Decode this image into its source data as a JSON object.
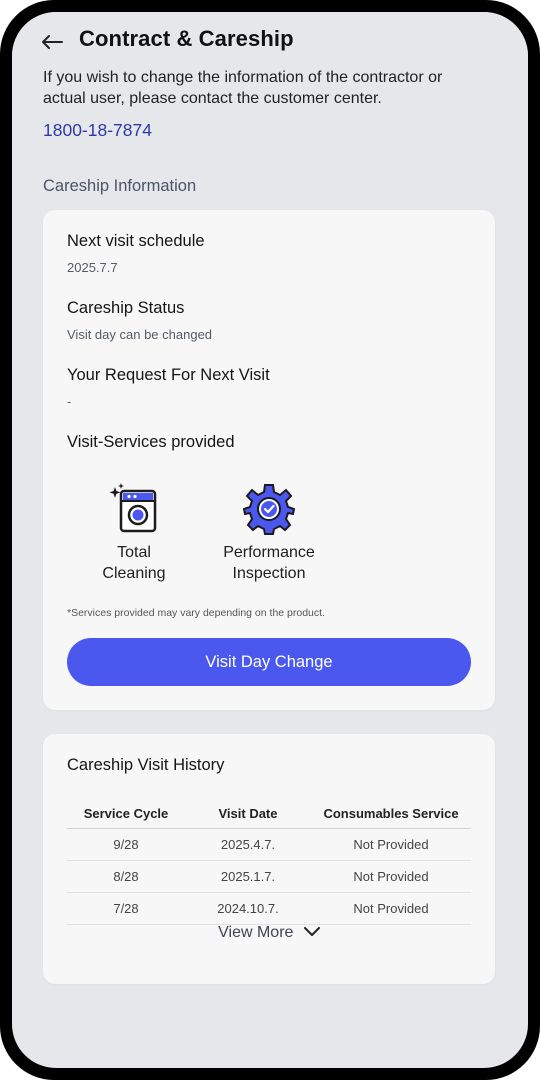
{
  "header": {
    "title": "Contract & Careship",
    "back_icon": "arrow-left-icon"
  },
  "notice": {
    "text": "If you wish to change the information of the contractor or actual user, please contact the customer center.",
    "phone": "1800-18-7874"
  },
  "careship": {
    "section_title": "Careship Information",
    "next_visit_label": "Next visit schedule",
    "next_visit_value": "2025.7.7",
    "status_label": "Careship Status",
    "status_value": "Visit day can be changed",
    "request_label": "Your Request For Next Visit",
    "request_value": "-",
    "services_label": "Visit-Services provided",
    "services": [
      {
        "line1": "Total",
        "line2": "Cleaning",
        "icon": "washing-machine-sparkle-icon"
      },
      {
        "line1": "Performance",
        "line2": "Inspection",
        "icon": "gear-check-icon"
      }
    ],
    "footnote": "*Services provided may vary depending on the product.",
    "button_label": "Visit Day Change"
  },
  "history": {
    "title": "Careship Visit History",
    "columns": [
      "Service Cycle",
      "Visit Date",
      "Consumables Service"
    ],
    "rows": [
      [
        "9/28",
        "2025.4.7.",
        "Not Provided"
      ],
      [
        "8/28",
        "2025.1.7.",
        "Not Provided"
      ],
      [
        "7/28",
        "2024.10.7.",
        "Not Provided"
      ]
    ],
    "view_more": "View More"
  },
  "colors": {
    "accent": "#4a58f0",
    "link": "#2b3aa5",
    "icon_blue": "#4a58f0"
  }
}
